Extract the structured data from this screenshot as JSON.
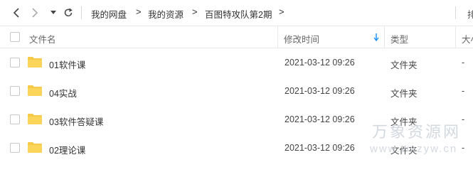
{
  "breadcrumb": {
    "items": [
      "我的网盘",
      "我的资源",
      "百图特攻队第2期"
    ],
    "separator": ">"
  },
  "toolbar": {
    "overflow_char": "排"
  },
  "columns": {
    "name": "文件名",
    "modified": "修改时间",
    "type": "类型",
    "size": "大小"
  },
  "rows": [
    {
      "name": "01软件课",
      "modified": "2021-03-12 09:26",
      "type": "文件夹",
      "size": "-"
    },
    {
      "name": "04实战",
      "modified": "2021-03-12 09:26",
      "type": "文件夹",
      "size": "-"
    },
    {
      "name": "03软件答疑课",
      "modified": "2021-03-12 09:26",
      "type": "文件夹",
      "size": "-"
    },
    {
      "name": "02理论课",
      "modified": "2021-03-12 09:26",
      "type": "文件夹",
      "size": "-"
    }
  ],
  "watermark": {
    "line1": "万象资源网",
    "line2": "www.wxzyw.cn"
  },
  "colors": {
    "folder": "#f7c948",
    "sort_arrow": "#1890ff"
  }
}
